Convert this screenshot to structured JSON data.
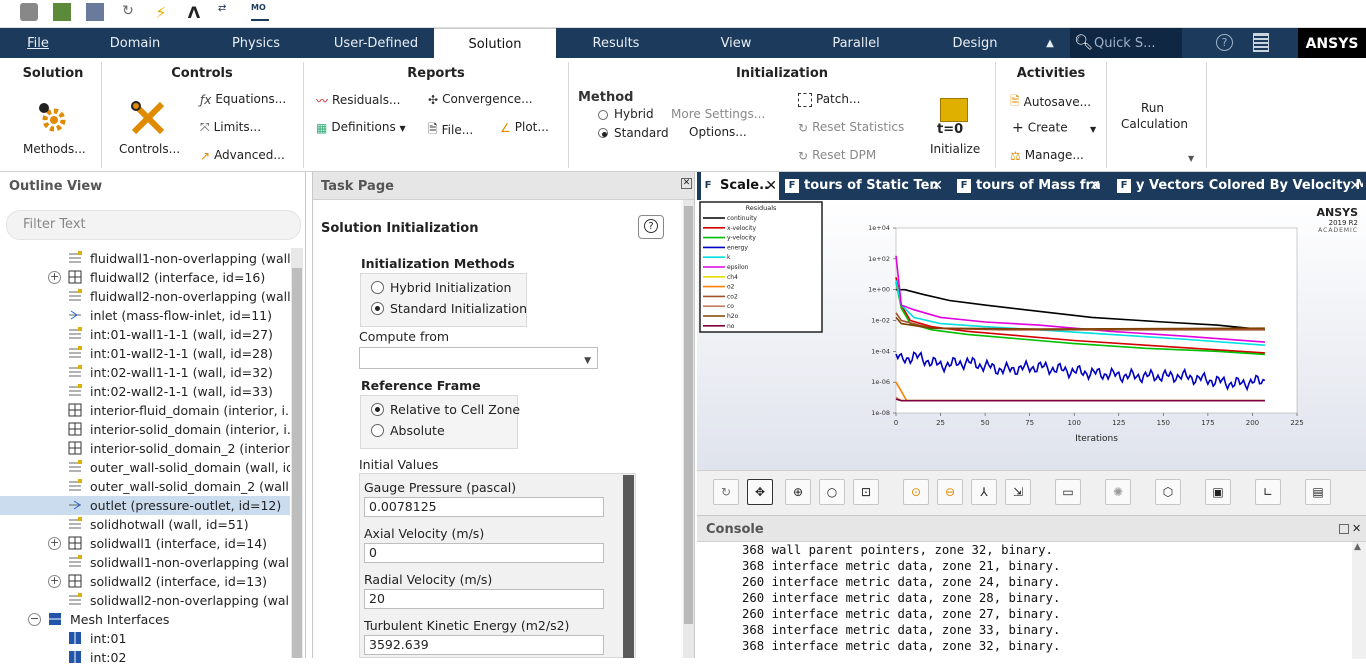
{
  "menubar": {
    "items": [
      "File",
      "Domain",
      "Physics",
      "User-Defined",
      "Solution",
      "Results",
      "View",
      "Parallel",
      "Design"
    ],
    "active": "Solution",
    "search_placeholder": "Quick S...",
    "brand": "ANSYS"
  },
  "ribbon": {
    "solution": {
      "title": "Solution",
      "methods": "Methods..."
    },
    "controls": {
      "title": "Controls",
      "controls": "Controls...",
      "equations": "Equations...",
      "limits": "Limits...",
      "advanced": "Advanced..."
    },
    "reports": {
      "title": "Reports",
      "residuals": "Residuals...",
      "convergence": "Convergence...",
      "definitions": "Definitions",
      "file": "File...",
      "plot": "Plot..."
    },
    "initialization": {
      "title": "Initialization",
      "method": "Method",
      "hybrid": "Hybrid",
      "standard": "Standard",
      "more_settings": "More Settings...",
      "options": "Options...",
      "patch": "Patch...",
      "reset_statistics": "Reset Statistics",
      "reset_dpm": "Reset DPM",
      "initialize": "Initialize",
      "t0": "t=0"
    },
    "activities": {
      "title": "Activities",
      "autosave": "Autosave...",
      "create": "Create",
      "manage": "Manage..."
    },
    "run": {
      "label1": "Run",
      "label2": "Calculation"
    }
  },
  "outline": {
    "title": "Outline View",
    "filter_placeholder": "Filter Text",
    "rows": [
      {
        "label": "fluidwall1-non-overlapping (wall...",
        "icon": "wall-icon",
        "exp": ""
      },
      {
        "label": "fluidwall2 (interface, id=16)",
        "icon": "interface-icon",
        "exp": "+"
      },
      {
        "label": "fluidwall2-non-overlapping (wall...",
        "icon": "wall-icon",
        "exp": ""
      },
      {
        "label": "inlet (mass-flow-inlet, id=11)",
        "icon": "inlet-icon",
        "exp": ""
      },
      {
        "label": "int:01-wall1-1-1 (wall, id=27)",
        "icon": "wall-icon",
        "exp": ""
      },
      {
        "label": "int:01-wall2-1-1 (wall, id=28)",
        "icon": "wall-icon",
        "exp": ""
      },
      {
        "label": "int:02-wall1-1-1 (wall, id=32)",
        "icon": "wall-icon",
        "exp": ""
      },
      {
        "label": "int:02-wall2-1-1 (wall, id=33)",
        "icon": "wall-icon",
        "exp": ""
      },
      {
        "label": "interior-fluid_domain (interior, i...",
        "icon": "interface-icon",
        "exp": ""
      },
      {
        "label": "interior-solid_domain (interior, i...",
        "icon": "interface-icon",
        "exp": ""
      },
      {
        "label": "interior-solid_domain_2 (interior...",
        "icon": "interface-icon",
        "exp": ""
      },
      {
        "label": "outer_wall-solid_domain (wall, id...",
        "icon": "wall-icon",
        "exp": ""
      },
      {
        "label": "outer_wall-solid_domain_2 (wall,...",
        "icon": "wall-icon",
        "exp": ""
      },
      {
        "label": "outlet (pressure-outlet, id=12)",
        "icon": "outlet-icon",
        "exp": "",
        "selected": true
      },
      {
        "label": "solidhotwall (wall, id=51)",
        "icon": "wall-icon",
        "exp": ""
      },
      {
        "label": "solidwall1 (interface, id=14)",
        "icon": "interface-icon",
        "exp": "+"
      },
      {
        "label": "solidwall1-non-overlapping (wal...",
        "icon": "wall-icon",
        "exp": ""
      },
      {
        "label": "solidwall2 (interface, id=13)",
        "icon": "interface-icon",
        "exp": "+"
      },
      {
        "label": "solidwall2-non-overlapping (wal...",
        "icon": "wall-icon",
        "exp": ""
      }
    ],
    "mesh_interfaces": "Mesh Interfaces",
    "mesh_children": [
      "int:01",
      "int:02"
    ]
  },
  "task": {
    "header": "Task Page",
    "title": "Solution Initialization",
    "methods_title": "Initialization Methods",
    "hybrid": "Hybrid  Initialization",
    "standard": "Standard Initialization",
    "compute_from": "Compute from",
    "reference_frame": "Reference Frame",
    "relative": "Relative to Cell Zone",
    "absolute": "Absolute",
    "initial_values": "Initial Values",
    "fields": [
      {
        "label": "Gauge Pressure (pascal)",
        "value": "0.0078125"
      },
      {
        "label": "Axial Velocity (m/s)",
        "value": "0"
      },
      {
        "label": "Radial Velocity (m/s)",
        "value": "20"
      },
      {
        "label": "Turbulent Kinetic Energy (m2/s2)",
        "value": "3592.639"
      }
    ]
  },
  "graphics": {
    "tabs": [
      {
        "label": "Scale.."
      },
      {
        "label": "tours of Static Ten"
      },
      {
        "label": "tours of Mass fra"
      },
      {
        "label": "y Vectors Colored By Velocity M"
      }
    ],
    "watermark": {
      "brand": "ANSYS",
      "version": "2019 R2",
      "edition": "ACADEMIC"
    }
  },
  "chart_data": {
    "type": "line",
    "title": "Residuals",
    "xlabel": "Iterations",
    "ylabel": "",
    "xlim": [
      0,
      225
    ],
    "ylim_log10": [
      -8,
      4
    ],
    "x_ticks": [
      "0",
      "25",
      "50",
      "75",
      "100",
      "125",
      "150",
      "175",
      "200",
      "225"
    ],
    "y_ticks": [
      "1e-08",
      "1e-06",
      "1e-04",
      "1e-02",
      "1e+00",
      "1e+02",
      "1e+04"
    ],
    "log_y": true,
    "series": [
      {
        "name": "continuity",
        "color": "#000000",
        "x": [
          0,
          5,
          15,
          30,
          50,
          80,
          110,
          150,
          180,
          207
        ],
        "log10y": [
          0,
          0,
          -0.3,
          -0.7,
          -1.0,
          -1.4,
          -1.8,
          -2.1,
          -2.3,
          -2.6
        ]
      },
      {
        "name": "x-velocity",
        "color": "#d40000",
        "x": [
          0,
          3,
          8,
          20,
          40,
          70,
          100,
          140,
          180,
          207
        ],
        "log10y": [
          0.8,
          -1.0,
          -2.0,
          -2.4,
          -2.7,
          -3.0,
          -3.3,
          -3.6,
          -3.9,
          -4.1
        ]
      },
      {
        "name": "y-velocity",
        "color": "#00c000",
        "x": [
          0,
          3,
          8,
          20,
          40,
          70,
          100,
          140,
          180,
          207
        ],
        "log10y": [
          0.5,
          -1.2,
          -2.2,
          -2.6,
          -2.9,
          -3.2,
          -3.5,
          -3.8,
          -4.0,
          -4.2
        ]
      },
      {
        "name": "energy",
        "color": "#0000c0",
        "x": [
          0,
          3,
          10,
          25,
          40,
          60,
          80,
          100,
          130,
          160,
          190,
          207
        ],
        "log10y": [
          -4.2,
          -4.6,
          -4.3,
          -4.9,
          -4.7,
          -5.2,
          -5.0,
          -5.3,
          -5.6,
          -5.6,
          -6.1,
          -5.9
        ]
      },
      {
        "name": "k",
        "color": "#00e0e0",
        "x": [
          0,
          3,
          10,
          25,
          50,
          80,
          120,
          160,
          207
        ],
        "log10y": [
          0.6,
          -1.0,
          -1.8,
          -2.2,
          -2.4,
          -2.6,
          -2.9,
          -3.2,
          -3.6
        ]
      },
      {
        "name": "epsilon",
        "color": "#e000e0",
        "x": [
          0,
          3,
          10,
          25,
          50,
          80,
          120,
          160,
          207
        ],
        "log10y": [
          2.2,
          -1.0,
          -1.3,
          -1.8,
          -2.1,
          -2.3,
          -2.7,
          -3.0,
          -3.4
        ]
      },
      {
        "name": "ch4",
        "color": "#e0e000",
        "x": [
          0,
          3,
          207
        ],
        "log10y": [
          -7.0,
          -7.2,
          -7.2
        ]
      },
      {
        "name": "o2",
        "color": "#ff8000",
        "x": [
          0,
          2,
          6,
          207
        ],
        "log10y": [
          -6.0,
          -6.4,
          -7.2,
          -7.2
        ]
      },
      {
        "name": "co2",
        "color": "#a0522d",
        "x": [
          0,
          3,
          20,
          60,
          207
        ],
        "log10y": [
          -1.5,
          -2.0,
          -2.5,
          -2.6,
          -2.6
        ]
      },
      {
        "name": "co",
        "color": "#c08060",
        "x": [
          0,
          3,
          207
        ],
        "log10y": [
          -7.0,
          -7.2,
          -7.2
        ]
      },
      {
        "name": "h2o",
        "color": "#804000",
        "x": [
          0,
          3,
          20,
          80,
          207
        ],
        "log10y": [
          -1.8,
          -2.2,
          -2.5,
          -2.55,
          -2.5
        ]
      },
      {
        "name": "no",
        "color": "#800040",
        "x": [
          0,
          3,
          207
        ],
        "log10y": [
          -7.1,
          -7.2,
          -7.2
        ]
      }
    ]
  },
  "console": {
    "title": "Console",
    "lines": [
      "368 wall parent pointers, zone 32, binary.",
      "368 interface metric data, zone 21, binary.",
      "260 interface metric data, zone 24, binary.",
      "260 interface metric data, zone 28, binary.",
      "260 interface metric data, zone 27, binary.",
      "368 interface metric data, zone 33, binary.",
      "368 interface metric data, zone 32, binary."
    ]
  }
}
